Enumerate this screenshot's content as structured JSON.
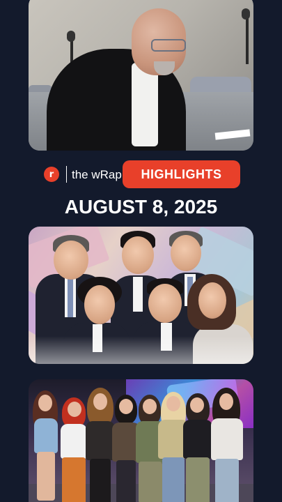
{
  "brand": {
    "logo_letter": "r",
    "name": "the wRap",
    "accent_color": "#e8402a"
  },
  "highlights_button": {
    "label": "HIGHLIGHTS"
  },
  "date_heading": "AUGUST 8, 2025",
  "icons": {
    "logo": "rappler-logo-icon"
  },
  "colors": {
    "background": "#131a2c",
    "accent": "#e8402a",
    "text": "#ffffff"
  }
}
